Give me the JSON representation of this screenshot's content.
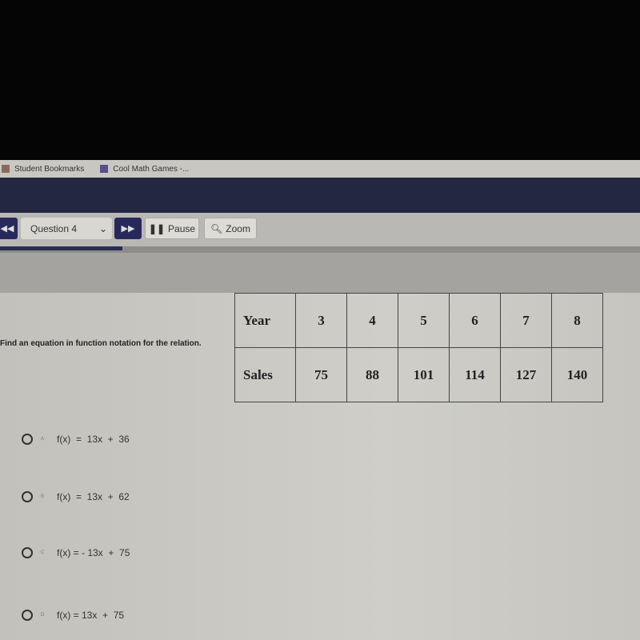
{
  "bookmarks": [
    {
      "label": "Student Bookmarks"
    },
    {
      "label": "Cool Math Games -..."
    }
  ],
  "toolbar": {
    "prev_icon": "rewind-icon",
    "question_select": "Question 4",
    "next_icon": "fast-forward-icon",
    "pause_label": "Pause",
    "zoom_label": "Zoom"
  },
  "question": {
    "prompt": "Find an equation in function notation for the relation.",
    "table": {
      "row1_header": "Year",
      "row1": [
        "3",
        "4",
        "5",
        "6",
        "7",
        "8"
      ],
      "row2_header": "Sales",
      "row2": [
        "75",
        "88",
        "101",
        "114",
        "127",
        "140"
      ]
    },
    "choices": [
      {
        "letter": "A",
        "text": "f(x)  =  13x  +  36"
      },
      {
        "letter": "B",
        "text": "f(x)  =  13x  +  62"
      },
      {
        "letter": "C",
        "text": "f(x) = - 13x  +  75"
      },
      {
        "letter": "D",
        "text": "f(x) = 13x  +  75"
      }
    ]
  },
  "colors": {
    "nav": "#232742",
    "button": "#28295a"
  }
}
